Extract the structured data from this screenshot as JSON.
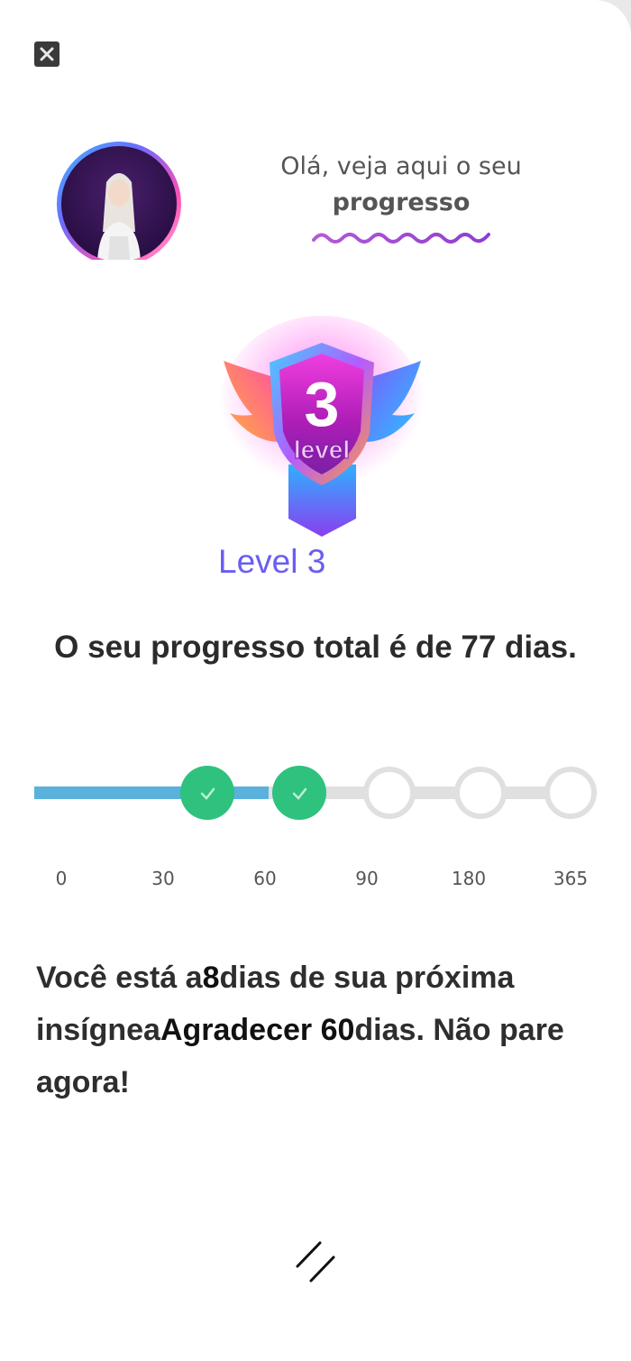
{
  "greeting": {
    "line1": "Olá, veja aqui o seu",
    "line2": "progresso"
  },
  "badge": {
    "number": "3",
    "word": "level"
  },
  "level_label": "Level 3",
  "progress": {
    "title": "O seu progresso total é de 77 dias.",
    "total_days": 77
  },
  "milestones": [
    {
      "label": "0"
    },
    {
      "label": "30",
      "completed": true
    },
    {
      "label": "60",
      "completed": true
    },
    {
      "label": "90",
      "completed": false
    },
    {
      "label": "180",
      "completed": false
    },
    {
      "label": "365",
      "completed": false
    }
  ],
  "message": {
    "p1": "Você está a",
    "days": "8",
    "p2": "dias de sua próxima insígnea",
    "badge_name": "Agradecer 60",
    "p3": "dias. Não pare agora!"
  },
  "icons": {
    "close": "close-icon",
    "check": "check-icon",
    "resize": "resize-handle-icon"
  },
  "colors": {
    "accent_purple": "#6a5df2",
    "progress_blue": "#5ab2dc",
    "completed_green": "#2ec27e",
    "pending_gray": "#e0e0e0"
  }
}
